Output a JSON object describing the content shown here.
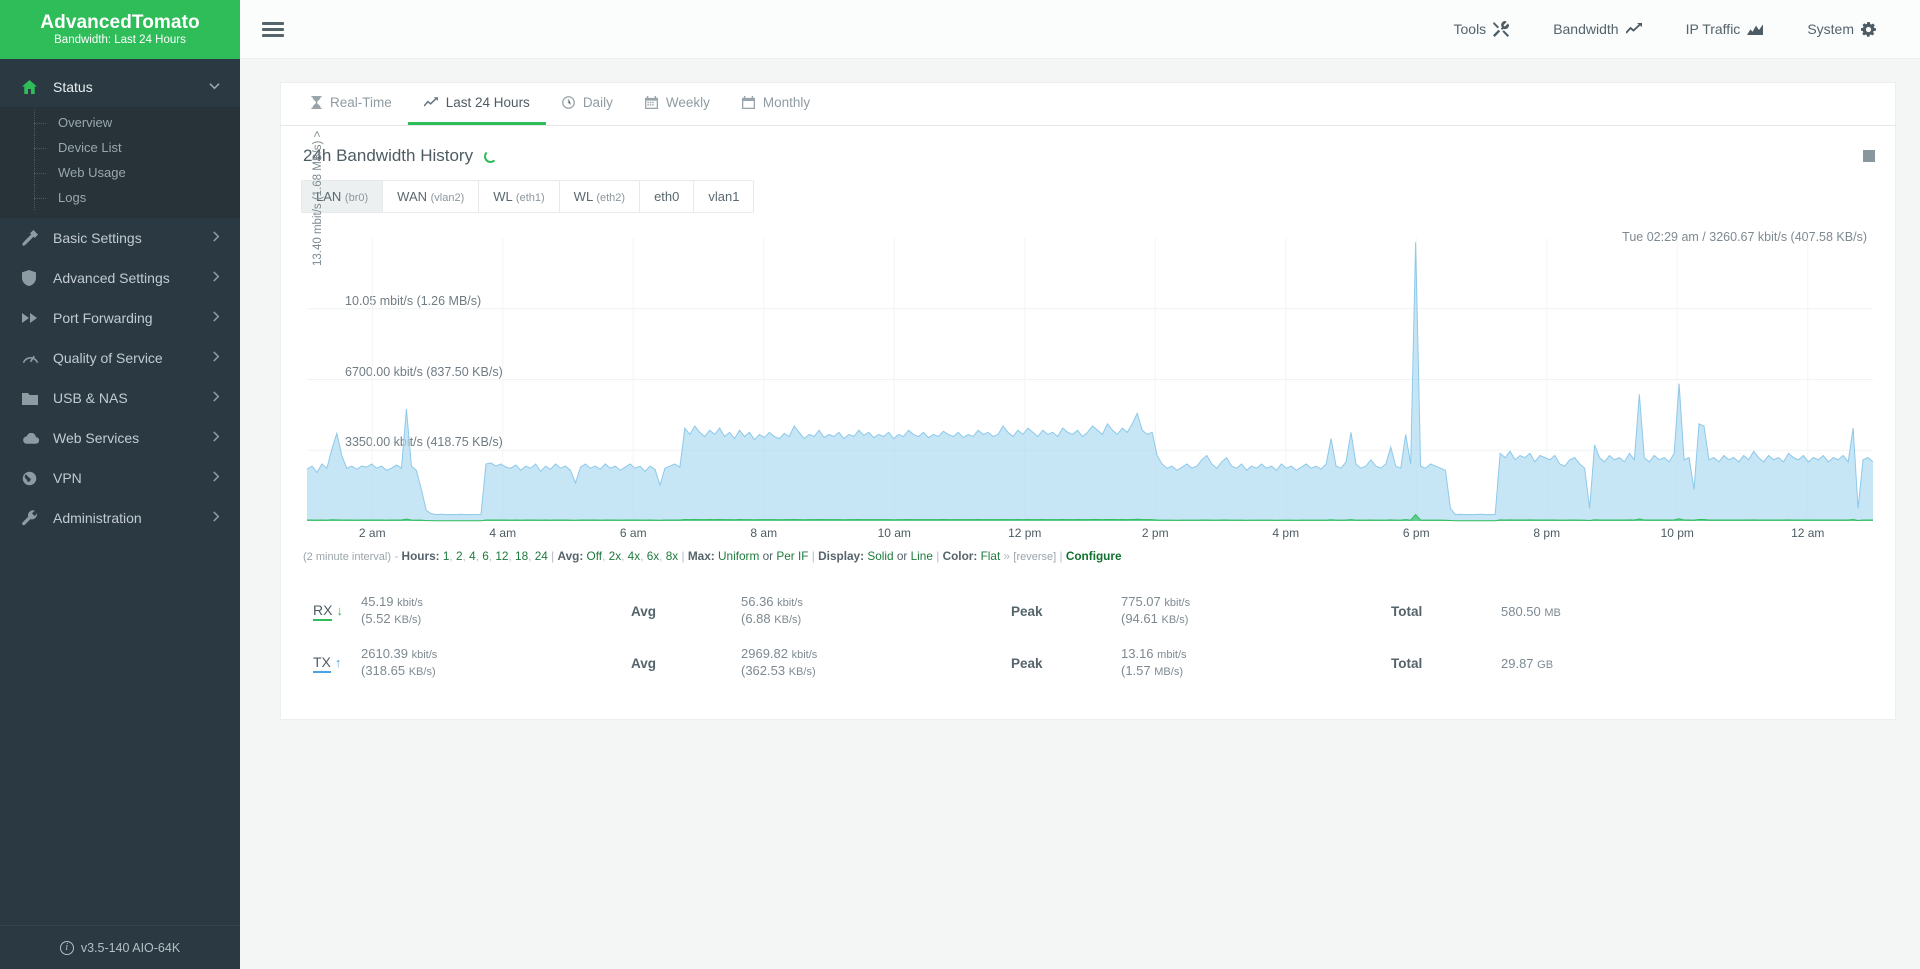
{
  "brand": {
    "title_bold": "Advanced",
    "title_light": "Tomato",
    "subtitle": "Bandwidth: Last 24 Hours"
  },
  "sidebar": {
    "status": {
      "label": "Status",
      "icon": "home-icon",
      "chevron": "⌄"
    },
    "status_children": [
      {
        "label": "Overview"
      },
      {
        "label": "Device List"
      },
      {
        "label": "Web Usage"
      },
      {
        "label": "Logs"
      }
    ],
    "items": [
      {
        "label": "Basic Settings",
        "icon": "hammer-icon"
      },
      {
        "label": "Advanced Settings",
        "icon": "shield-icon"
      },
      {
        "label": "Port Forwarding",
        "icon": "forward-icon"
      },
      {
        "label": "Quality of Service",
        "icon": "gauge-icon"
      },
      {
        "label": "USB & NAS",
        "icon": "folder-icon"
      },
      {
        "label": "Web Services",
        "icon": "cloud-icon"
      },
      {
        "label": "VPN",
        "icon": "globe-icon"
      },
      {
        "label": "Administration",
        "icon": "wrench-icon"
      }
    ],
    "footer": {
      "version": "v3.5-140 AIO-64K",
      "icon": "info-icon"
    }
  },
  "topnav": {
    "menu_icon": "hamburger-icon",
    "links": [
      {
        "label": "Tools",
        "icon": "tools-icon"
      },
      {
        "label": "Bandwidth",
        "icon": "line-chart-icon"
      },
      {
        "label": "IP Traffic",
        "icon": "area-chart-icon"
      },
      {
        "label": "System",
        "icon": "gear-icon"
      }
    ]
  },
  "view_tabs": [
    {
      "label": "Real-Time",
      "icon": "hourglass-icon",
      "active": false
    },
    {
      "label": "Last 24 Hours",
      "icon": "line-chart-icon",
      "active": true
    },
    {
      "label": "Daily",
      "icon": "clock-icon",
      "active": false
    },
    {
      "label": "Weekly",
      "icon": "calendar-icon",
      "active": false
    },
    {
      "label": "Monthly",
      "icon": "calendar-icon",
      "active": false
    }
  ],
  "card": {
    "title": "24h Bandwidth History",
    "spinner": "loading-spinner",
    "minimize_icon": "minimize-icon"
  },
  "interface_tabs": [
    {
      "name": "LAN",
      "sub": "(br0)",
      "active": true
    },
    {
      "name": "WAN",
      "sub": "(vlan2)",
      "active": false
    },
    {
      "name": "WL",
      "sub": "(eth1)",
      "active": false
    },
    {
      "name": "WL",
      "sub": "(eth2)",
      "active": false
    },
    {
      "name": "eth0",
      "sub": "",
      "active": false
    },
    {
      "name": "vlan1",
      "sub": "",
      "active": false
    }
  ],
  "chart_data": {
    "type": "area",
    "title": "24h Bandwidth History",
    "annotation": "Tue 02:29 am / 3260.67 kbit/s (407.58 KB/s)",
    "ylabel": "13.40 mbit/s (1.68 MB/s) >",
    "ytick_labels": [
      "10.05 mbit/s (1.26 MB/s)",
      "6700.00 kbit/s (837.50 KB/s)",
      "3350.00 kbit/s (418.75 KB/s)"
    ],
    "ytick_values": [
      10050,
      6700,
      3350
    ],
    "ylim": [
      0,
      13400
    ],
    "yunit": "kbit/s",
    "xlabel": "",
    "xtick_labels": [
      "2 am",
      "4 am",
      "6 am",
      "8 am",
      "10 am",
      "12 pm",
      "2 pm",
      "4 pm",
      "6 pm",
      "8 pm",
      "10 pm",
      "12 am"
    ],
    "grid": true,
    "legend_position": "none",
    "interval": "2 minute interval",
    "series": [
      {
        "name": "TX",
        "color": "#8ec9ea",
        "fill": "#b3dcf2",
        "values": [
          2450,
          2600,
          2300,
          2700,
          2500,
          3400,
          4150,
          3100,
          2500,
          2600,
          2450,
          2600,
          2550,
          2700,
          2500,
          2600,
          2400,
          2500,
          2650,
          2500,
          5300,
          2600,
          2400,
          1500,
          500,
          350,
          300,
          320,
          300,
          310,
          300,
          320,
          300,
          310,
          300,
          320,
          2700,
          2750,
          2600,
          2700,
          2550,
          2500,
          2650,
          2400,
          2600,
          2500,
          2700,
          2350,
          2600,
          2450,
          2700,
          2500,
          2600,
          2400,
          1800,
          2550,
          2700,
          2500,
          2600,
          2450,
          2700,
          2500,
          2600,
          2400,
          2550,
          2700,
          2500,
          2600,
          2350,
          2600,
          2450,
          1700,
          2500,
          2600,
          2700,
          2550,
          4400,
          4100,
          4500,
          4200,
          4000,
          4300,
          4100,
          4400,
          4000,
          4200,
          3900,
          4300,
          4000,
          4200,
          3850,
          4100,
          3950,
          4200,
          4000,
          3900,
          4150,
          4000,
          4500,
          4200,
          3900,
          4100,
          4000,
          4300,
          3950,
          4100,
          4000,
          4200,
          3900,
          4100,
          4000,
          4300,
          4050,
          4200,
          3950,
          4100,
          4000,
          4200,
          3900,
          4100,
          4000,
          4300,
          4100,
          4000,
          4200,
          3950,
          4100,
          4000,
          4250,
          4100,
          4000,
          4200,
          3950,
          4100,
          4000,
          4300,
          4100,
          4200,
          4000,
          4100,
          4500,
          4200,
          4000,
          4300,
          4100,
          4400,
          4200,
          4000,
          4300,
          4100,
          4200,
          4000,
          4400,
          4200,
          4100,
          4300,
          4000,
          4200,
          4500,
          4300,
          4100,
          4600,
          4300,
          4100,
          4400,
          4200,
          4600,
          5100,
          4300,
          4100,
          4200,
          3100,
          2700,
          2500,
          2600,
          2400,
          2550,
          2700,
          2500,
          2600,
          2900,
          3100,
          2700,
          2500,
          2800,
          3000,
          2600,
          2500,
          2700,
          2400,
          2600,
          2500,
          2700,
          2500,
          2600,
          2400,
          2700,
          2500,
          2600,
          2400,
          2550,
          2700,
          2500,
          2600,
          2450,
          2700,
          3900,
          2600,
          2500,
          2800,
          4200,
          2700,
          2500,
          2600,
          2900,
          2600,
          2500,
          2700,
          3500,
          2600,
          2500,
          4100,
          2700,
          13200,
          2600,
          2500,
          2700,
          2600,
          2500,
          2400,
          600,
          300,
          320,
          300,
          310,
          300,
          320,
          300,
          310,
          300,
          3200,
          3000,
          3300,
          2900,
          3100,
          3000,
          3200,
          2800,
          3100,
          3000,
          2900,
          3100,
          2700,
          2600,
          2900,
          3000,
          2700,
          2500,
          600,
          3600,
          3000,
          2800,
          3100,
          2900,
          3000,
          2800,
          3200,
          2900,
          6000,
          3000,
          2800,
          3100,
          2900,
          3000,
          2800,
          3200,
          6500,
          2900,
          3000,
          1500,
          4600,
          4500,
          2900,
          3000,
          2800,
          3100,
          2900,
          3000,
          2800,
          3100,
          2900,
          3300,
          3000,
          2800,
          3100,
          2900,
          3000,
          2800,
          3200,
          3000,
          2900,
          3100,
          2800,
          3000,
          2900,
          3100,
          2800,
          3000,
          2900,
          3100,
          2800,
          4400,
          600,
          2900,
          3000,
          2800
        ]
      },
      {
        "name": "RX",
        "color": "#2ebd59",
        "fill": "#56c98a",
        "values": [
          45,
          50,
          42,
          48,
          44,
          60,
          55,
          47,
          45,
          46,
          44,
          48,
          45,
          47,
          45,
          46,
          44,
          45,
          47,
          45,
          90,
          46,
          44,
          40,
          20,
          15,
          12,
          14,
          12,
          13,
          12,
          14,
          12,
          13,
          12,
          14,
          48,
          49,
          46,
          48,
          45,
          44,
          47,
          43,
          46,
          45,
          48,
          42,
          46,
          44,
          48,
          45,
          46,
          43,
          35,
          45,
          48,
          45,
          46,
          44,
          48,
          45,
          46,
          43,
          45,
          48,
          45,
          46,
          42,
          46,
          44,
          33,
          45,
          46,
          48,
          45,
          70,
          66,
          72,
          67,
          64,
          69,
          66,
          70,
          64,
          67,
          62,
          69,
          64,
          67,
          61,
          66,
          63,
          67,
          64,
          62,
          66,
          64,
          72,
          67,
          62,
          66,
          64,
          69,
          63,
          66,
          64,
          67,
          62,
          66,
          64,
          69,
          65,
          67,
          63,
          66,
          64,
          67,
          62,
          66,
          64,
          69,
          66,
          64,
          67,
          63,
          66,
          64,
          68,
          66,
          64,
          67,
          63,
          66,
          64,
          69,
          66,
          67,
          64,
          66,
          72,
          67,
          64,
          69,
          66,
          70,
          67,
          64,
          69,
          66,
          67,
          64,
          70,
          67,
          66,
          69,
          64,
          67,
          72,
          69,
          66,
          74,
          69,
          66,
          70,
          67,
          74,
          82,
          69,
          66,
          67,
          50,
          43,
          40,
          42,
          38,
          41,
          43,
          40,
          42,
          46,
          50,
          43,
          40,
          45,
          48,
          42,
          40,
          43,
          38,
          42,
          40,
          43,
          40,
          42,
          38,
          43,
          40,
          42,
          38,
          41,
          43,
          40,
          42,
          39,
          43,
          62,
          42,
          40,
          45,
          67,
          43,
          40,
          42,
          46,
          42,
          40,
          43,
          56,
          42,
          40,
          66,
          43,
          300,
          42,
          40,
          43,
          42,
          40,
          38,
          24,
          12,
          13,
          12,
          12,
          12,
          13,
          12,
          12,
          12,
          51,
          48,
          53,
          46,
          50,
          48,
          51,
          45,
          50,
          48,
          46,
          50,
          43,
          42,
          46,
          48,
          43,
          40,
          24,
          58,
          48,
          45,
          50,
          46,
          48,
          45,
          51,
          46,
          96,
          48,
          45,
          50,
          46,
          48,
          45,
          51,
          104,
          46,
          48,
          40,
          74,
          72,
          46,
          48,
          45,
          50,
          46,
          48,
          45,
          50,
          46,
          53,
          48,
          45,
          50,
          46,
          48,
          45,
          51,
          48,
          46,
          50,
          45,
          48,
          46,
          50,
          45,
          48,
          46,
          50,
          45,
          70,
          24,
          46,
          48,
          45
        ]
      }
    ]
  },
  "options_line": {
    "interval_text": "(2 minute interval)",
    "dash": "-",
    "hours_label": "Hours:",
    "hours": [
      "1",
      "2",
      "4",
      "6",
      "12",
      "18",
      "24"
    ],
    "avg_label": "Avg:",
    "avg": [
      "Off",
      "2x",
      "4x",
      "6x",
      "8x"
    ],
    "max_label": "Max:",
    "max_uniform": "Uniform",
    "max_or": "or",
    "max_perif": "Per IF",
    "display_label": "Display:",
    "display_solid": "Solid",
    "display_or": "or",
    "display_line": "Line",
    "color_label": "Color:",
    "color_flat": "Flat",
    "color_chevron": "»",
    "color_reverse": "[reverse]",
    "configure": "Configure"
  },
  "stats": {
    "rows": [
      {
        "dir": "RX",
        "arrow": "↓",
        "cur_main": "45.19",
        "cur_unit": "kbit/s",
        "cur_sub": "(5.52",
        "cur_sub_unit": "KB/s)",
        "avg_label": "Avg",
        "avg_main": "56.36",
        "avg_unit": "kbit/s",
        "avg_sub": "(6.88",
        "avg_sub_unit": "KB/s)",
        "peak_label": "Peak",
        "peak_main": "775.07",
        "peak_unit": "kbit/s",
        "peak_sub": "(94.61",
        "peak_sub_unit": "KB/s)",
        "total_label": "Total",
        "total_main": "580.50",
        "total_unit": "MB"
      },
      {
        "dir": "TX",
        "arrow": "↑",
        "cur_main": "2610.39",
        "cur_unit": "kbit/s",
        "cur_sub": "(318.65",
        "cur_sub_unit": "KB/s)",
        "avg_label": "Avg",
        "avg_main": "2969.82",
        "avg_unit": "kbit/s",
        "avg_sub": "(362.53",
        "avg_sub_unit": "KB/s)",
        "peak_label": "Peak",
        "peak_main": "13.16",
        "peak_unit": "mbit/s",
        "peak_sub": "(1.57",
        "peak_sub_unit": "MB/s)",
        "total_label": "Total",
        "total_main": "29.87",
        "total_unit": "GB"
      }
    ]
  },
  "colors": {
    "brand_green": "#2ebd59",
    "sidebar": "#2b3a42",
    "tx_blue": "#8ec9ea",
    "page_bg": "#f4f6f6"
  }
}
